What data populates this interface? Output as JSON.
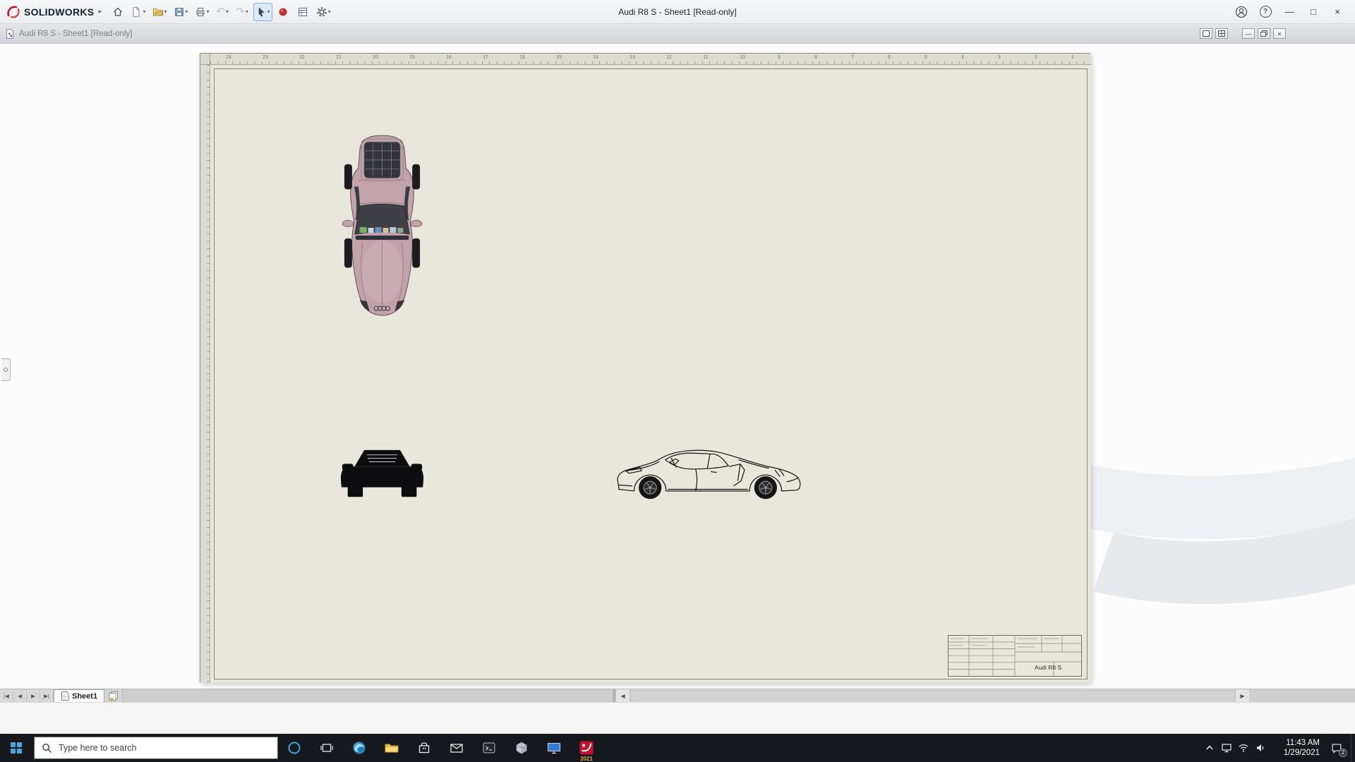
{
  "app": {
    "brand": "SOLIDWORKS",
    "title": "Audi R8 S - Sheet1 [Read-only]",
    "logo_caret": "▸"
  },
  "icons": {
    "dropdown": "▾",
    "undo": "↶",
    "redo": "↷",
    "help": "?",
    "minimize": "—",
    "maximize": "□",
    "close": "×"
  },
  "child_window": {
    "title": "Audi R8 S - Sheet1 [Read-only]",
    "minimize": "—",
    "close": "×"
  },
  "rulers": {
    "top_numbers": [
      "24",
      "23",
      "22",
      "21",
      "20",
      "19",
      "18",
      "17",
      "16",
      "15",
      "14",
      "13",
      "12",
      "11",
      "10",
      "9",
      "8",
      "7",
      "6",
      "5",
      "4",
      "3",
      "2",
      "1"
    ]
  },
  "sheet": {
    "tab_label": "Sheet1",
    "title_block_title": "Audi R8 S"
  },
  "tabnav": {
    "first": "|◀",
    "prev": "◀",
    "next": "▶",
    "last": "▶|"
  },
  "hscroll": {
    "left": "◀",
    "right": "▶"
  },
  "taskbar": {
    "search_placeholder": "Type here to search",
    "sw_year": "2021",
    "time": "11:43 AM",
    "date": "1/29/2021",
    "notification_count": "2"
  },
  "colors": {
    "accent_red": "#c8102e",
    "paper": "#e9e7dc",
    "taskbar": "#15181d"
  }
}
